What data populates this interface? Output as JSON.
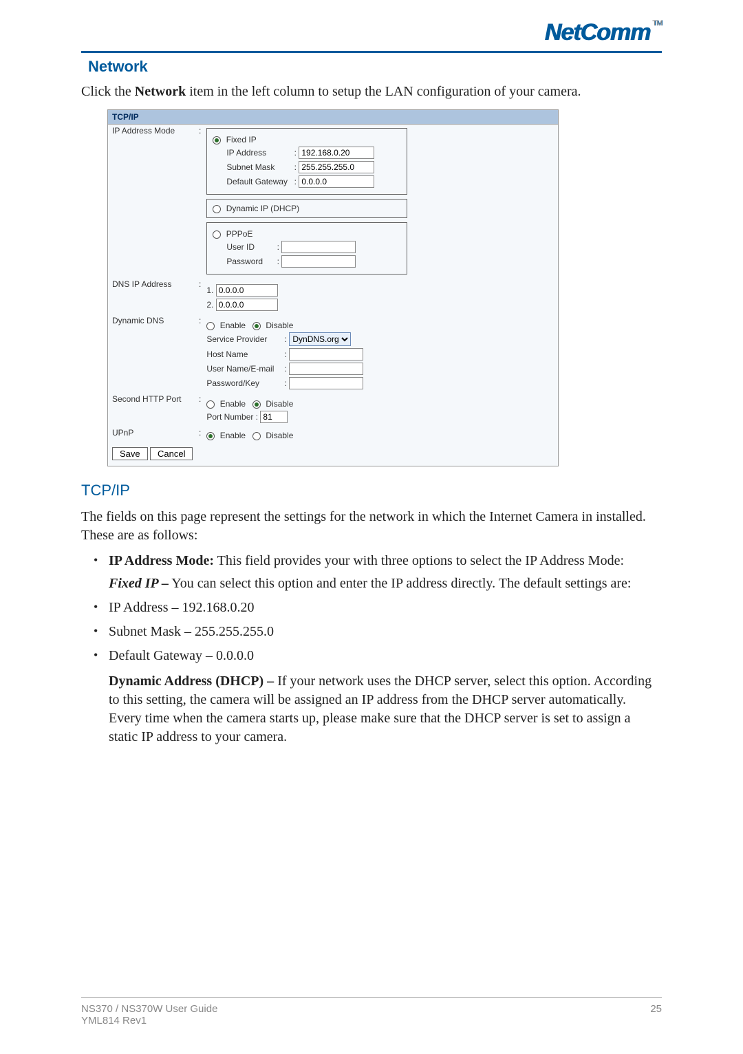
{
  "brand": {
    "name": "NetComm",
    "tm": "TM"
  },
  "headings": {
    "network": "Network",
    "tcpip": "TCP/IP"
  },
  "intro": {
    "prefix": "Click the ",
    "bold": "Network",
    "suffix": " item in the left column to setup the LAN configuration of your camera."
  },
  "screenshot": {
    "tab": "TCP/IP",
    "ip_mode": {
      "label": "IP Address Mode",
      "fixed": {
        "radio": "Fixed IP",
        "rows": {
          "ip": {
            "label": "IP Address",
            "value": "192.168.0.20"
          },
          "mask": {
            "label": "Subnet Mask",
            "value": "255.255.255.0"
          },
          "gw": {
            "label": "Default Gateway",
            "value": "0.0.0.0"
          }
        }
      },
      "dhcp": {
        "radio": "Dynamic IP (DHCP)"
      },
      "pppoe": {
        "radio": "PPPoE",
        "user": "User ID",
        "pass": "Password"
      }
    },
    "dns": {
      "label": "DNS IP Address",
      "one": {
        "num": "1.",
        "value": "0.0.0.0"
      },
      "two": {
        "num": "2.",
        "value": "0.0.0.0"
      }
    },
    "ddns": {
      "label": "Dynamic DNS",
      "enable": "Enable",
      "disable": "Disable",
      "sp": {
        "label": "Service Provider",
        "value": "DynDNS.org"
      },
      "host": "Host Name",
      "user": "User Name/E-mail",
      "key": "Password/Key"
    },
    "http2": {
      "label": "Second HTTP Port",
      "enable": "Enable",
      "disable": "Disable",
      "port": {
        "label": "Port Number",
        "value": "81"
      }
    },
    "upnp": {
      "label": "UPnP",
      "enable": "Enable",
      "disable": "Disable"
    },
    "buttons": {
      "save": "Save",
      "cancel": "Cancel"
    }
  },
  "tcpip_desc": {
    "intro": "The fields on this page represent the settings for the network in which the Internet Camera in installed. These are as follows:",
    "bullets": {
      "mode_b": "IP Address Mode:",
      "mode_t": " This field provides your with three options to select the IP Address Mode:",
      "fixed_bi": "Fixed IP –",
      "fixed_t": " You can select this option and enter the IP address directly.  The default settings are:",
      "ip": "IP Address – 192.168.0.20",
      "mask": "Subnet Mask – 255.255.255.0",
      "gw": "Default Gateway – 0.0.0.0",
      "dhcp_b": "Dynamic Address (DHCP) –",
      "dhcp_t": " If your network uses the DHCP server, select this option.  According to this setting, the camera will be assigned an IP address from the DHCP server automatically.  Every time when the camera starts up, please make sure that the DHCP server is set to assign a static IP address to your camera."
    }
  },
  "footer": {
    "line1": "NS370 / NS370W User Guide",
    "line2": "YML814 Rev1",
    "page": "25"
  }
}
